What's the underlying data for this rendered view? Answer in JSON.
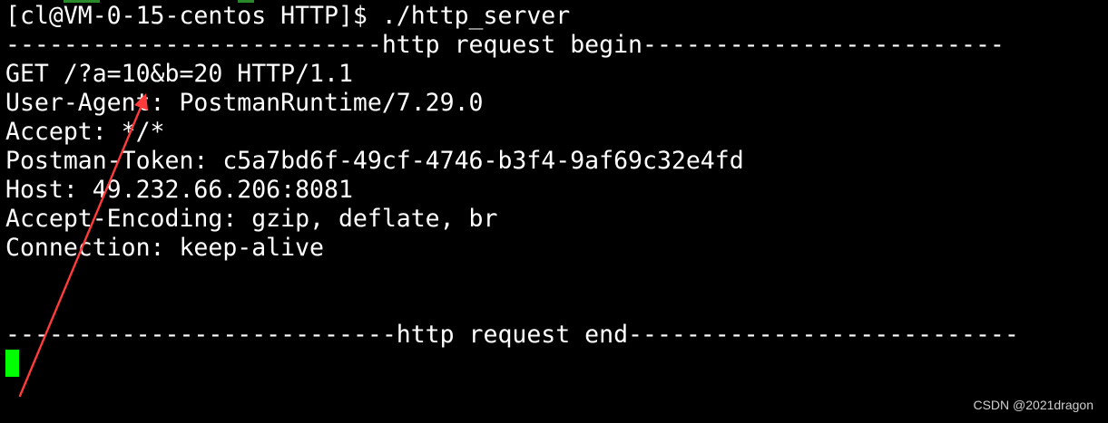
{
  "terminal": {
    "prompt_line": "[cl@VM-0-15-centos HTTP]$ ./http_server",
    "begin_line": "--------------------------http request begin-------------------------",
    "request_line": "GET /?a=10&b=20 HTTP/1.1",
    "headers": [
      "User-Agent: PostmanRuntime/7.29.0",
      "Accept: */*",
      "Postman-Token: c5a7bd6f-49cf-4746-b3f4-9af69c32e4fd",
      "Host: 49.232.66.206:8081",
      "Accept-Encoding: gzip, deflate, br",
      "Connection: keep-alive"
    ],
    "end_line": "---------------------------http request end---------------------------"
  },
  "colors": {
    "background": "#000000",
    "text": "#ffffff",
    "cursor": "#00ff00",
    "annotation_arrow": "#ff3b3b"
  },
  "watermark": "CSDN @2021dragon"
}
